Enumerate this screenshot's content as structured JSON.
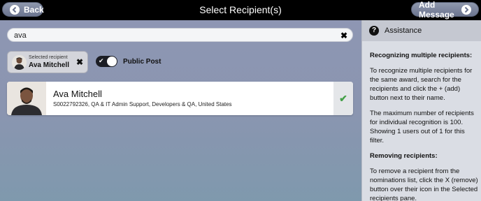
{
  "header": {
    "title": "Select Recipient(s)",
    "back_label": "Back",
    "add_label": "Add Message"
  },
  "search": {
    "value": "ava",
    "clear_symbol": "✖"
  },
  "selected": {
    "caption": "Selected recipient",
    "name": "Ava Mitchell",
    "remove_symbol": "✖"
  },
  "public_post": {
    "label": "Public Post",
    "enabled": true,
    "tick": "✔"
  },
  "result": {
    "name": "Ava Mitchell",
    "details": "S0022792326,  QA & IT Admin Support,  Developers & QA,  United States",
    "check_symbol": "✔"
  },
  "assistance": {
    "title": "Assistance",
    "icon": "?",
    "sections": [
      {
        "heading": "Recognizing multiple recipients:",
        "paragraphs": [
          "To recognize multiple recipients for the same award, search for the recipients and click the + (add) button next to their name.",
          "The maximum number of recipients for individual recognition is 100. Showing 1 users out of 1 for this filter."
        ]
      },
      {
        "heading": "Removing recipients:",
        "paragraphs": [
          "To remove a recipient from the nominations list, click the X (remove) button over their icon in the Selected recipients pane."
        ]
      }
    ]
  },
  "colors": {
    "accent_green": "#43a047",
    "header_bg": "#000000",
    "button_bg": "#7a829a"
  }
}
